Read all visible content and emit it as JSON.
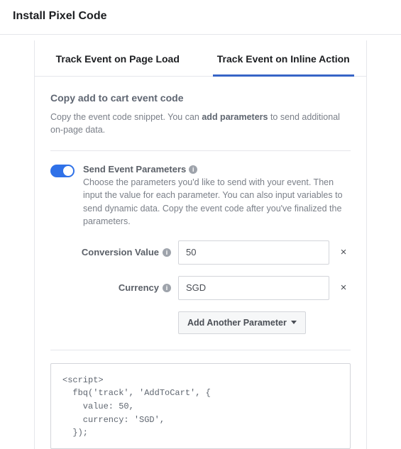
{
  "header": {
    "title": "Install Pixel Code"
  },
  "tabs": {
    "page_load": "Track Event on Page Load",
    "inline_action": "Track Event on Inline Action"
  },
  "section": {
    "title": "Copy add to cart event code",
    "desc_pre": "Copy the event code snippet. You can ",
    "desc_bold": "add parameters",
    "desc_post": " to send additional on-page data."
  },
  "toggle": {
    "title": "Send Event Parameters",
    "desc": "Choose the parameters you'd like to send with your event. Then input the value for each parameter. You can also input variables to send dynamic data. Copy the event code after you've finalized the parameters."
  },
  "params": {
    "conversion_value": {
      "label": "Conversion Value",
      "value": "50"
    },
    "currency": {
      "label": "Currency",
      "value": "SGD"
    }
  },
  "add_param_label": "Add Another Parameter",
  "code_snippet": "<script>\n  fbq('track', 'AddToCart', {\n    value: 50,\n    currency: 'SGD',\n  });"
}
